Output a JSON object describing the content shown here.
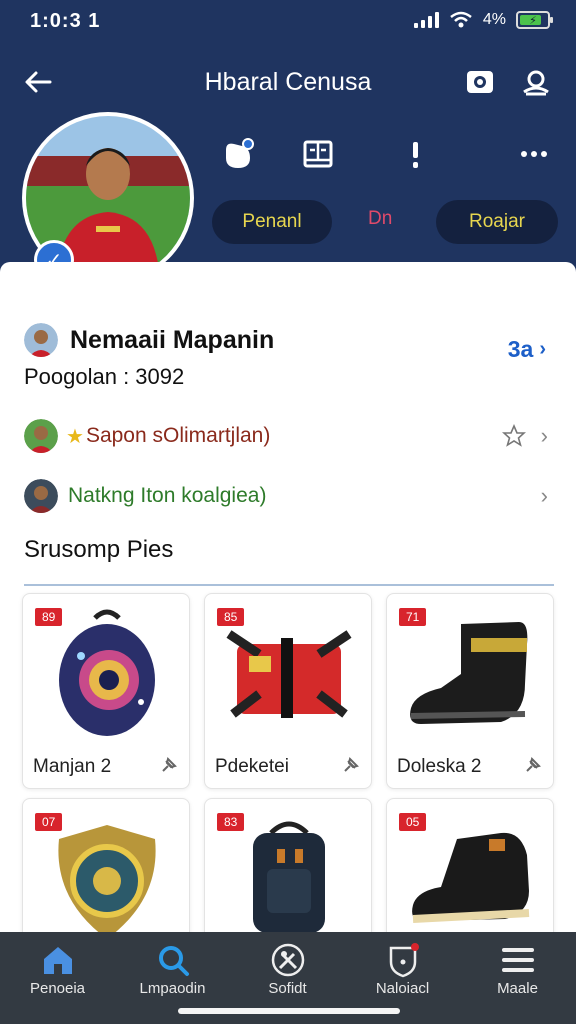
{
  "status_bar": {
    "time": "1:0:3 1",
    "battery_percent_label": "4%"
  },
  "nav": {
    "title": "Hbaral Cenusa"
  },
  "action_pills": [
    {
      "label": "Penanl"
    },
    {
      "label": "Dn"
    },
    {
      "label": "Roajar"
    }
  ],
  "profile": {
    "name": "Nemaaii Mapanin",
    "points_label": "Poogolan : 3092",
    "count_label": "3a"
  },
  "list_rows": [
    {
      "label": "Sapon sOlimartjlan)",
      "color": "#8a2a1c"
    },
    {
      "label": "Natkng Iton koalgiea)",
      "color": "#2e7b2a"
    }
  ],
  "section": {
    "title": "Srusomp Pies"
  },
  "products": [
    {
      "tag": "89",
      "name": "Manjan 2"
    },
    {
      "tag": "85",
      "name": "Pdeketei"
    },
    {
      "tag": "71",
      "name": "Doleska 2"
    },
    {
      "tag": "07",
      "name": ""
    },
    {
      "tag": "83",
      "name": ""
    },
    {
      "tag": "05",
      "name": ""
    }
  ],
  "bottom_nav": [
    {
      "label": "Penoeia",
      "icon": "home-icon"
    },
    {
      "label": "Lmpaodin",
      "icon": "search-icon"
    },
    {
      "label": "Sofidt",
      "icon": "tools-icon"
    },
    {
      "label": "Naloiacl",
      "icon": "notification-icon"
    },
    {
      "label": "Maale",
      "icon": "menu-icon"
    }
  ],
  "colors": {
    "header": "#1f3460",
    "accent": "#2c6fd3",
    "pill_text": "#e7d64f",
    "tag": "#d8242c"
  }
}
